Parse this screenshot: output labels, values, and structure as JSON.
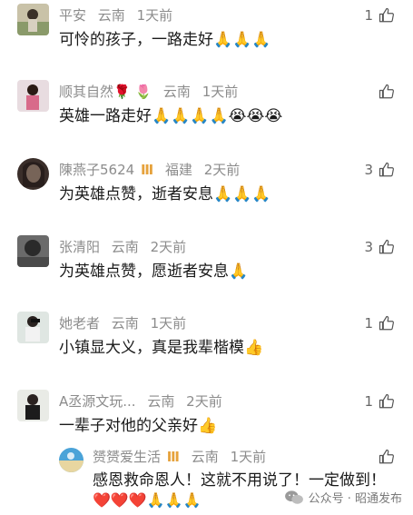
{
  "comments": [
    {
      "username": "平安",
      "location": "云南",
      "time": "1天前",
      "likes": "1",
      "text": "可怜的孩子，一路走好🙏🙏🙏"
    },
    {
      "username": "顺其自然🌹 🌷",
      "location": "云南",
      "time": "1天前",
      "likes": "",
      "text": "英雄一路走好🙏🙏🙏🙏😭😭😭"
    },
    {
      "username": "陳燕子5624",
      "badge": "Ⅲ",
      "location": "福建",
      "time": "2天前",
      "likes": "3",
      "text": "为英雄点赞，逝者安息🙏🙏🙏"
    },
    {
      "username": "张清阳",
      "location": "云南",
      "time": "2天前",
      "likes": "3",
      "text": "为英雄点赞，愿逝者安息🙏"
    },
    {
      "username": "她老者",
      "location": "云南",
      "time": "1天前",
      "likes": "1",
      "text": "小镇显大义，真是我辈楷模👍"
    },
    {
      "username": "A丞源文玩...",
      "location": "云南",
      "time": "2天前",
      "likes": "1",
      "text": "一辈子对他的父亲好👍"
    }
  ],
  "reply": {
    "username": "赟赟爱生活",
    "badge": "Ⅲ",
    "location": "云南",
    "time": "1天前",
    "text": "感恩救命恩人！这就不用说了！一定做到！",
    "emoji": "❤️❤️❤️🙏🙏🙏"
  },
  "watermark": {
    "text": "公众号 · 昭通发布"
  },
  "colors": {
    "meta": "#8c8c8c",
    "text": "#1a1a1a",
    "badge": "#e6a23c"
  }
}
